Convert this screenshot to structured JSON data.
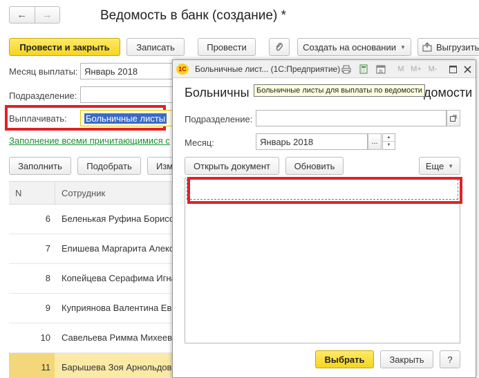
{
  "main": {
    "title": "Ведомость в банк (создание) *",
    "nav": {
      "back": "←",
      "forward": "→"
    },
    "toolbar": {
      "post_close": "Провести и закрыть",
      "save": "Записать",
      "post": "Провести",
      "create_based": "Создать на основании",
      "upload": "Выгрузить"
    },
    "fields": {
      "month_label": "Месяц выплаты:",
      "month_value": "Январь 2018",
      "department_label": "Подразделение:",
      "department_value": "",
      "pay_label": "Выплачивать:",
      "pay_value": "Больничные листы"
    },
    "fill_link": "Заполнение всеми причитающимися с",
    "table_toolbar": {
      "fill": "Заполнить",
      "select": "Подобрать",
      "change": "Изм"
    },
    "table": {
      "columns": [
        "N",
        "Сотрудник"
      ],
      "rows": [
        {
          "n": "6",
          "name": "Беленькая Руфина Борисо"
        },
        {
          "n": "7",
          "name": "Епишева Маргарита Алекс"
        },
        {
          "n": "8",
          "name": "Копейцева Серафима Игна"
        },
        {
          "n": "9",
          "name": "Куприянова Валентина Ев"
        },
        {
          "n": "10",
          "name": "Савельева Римма Михеев"
        },
        {
          "n": "11",
          "name": "Барышева Зоя Арнольдов"
        }
      ]
    }
  },
  "dialog": {
    "window_title": "Больничные лист... (1С:Предприятие)",
    "title_left": "Больничны",
    "title_right": "домости",
    "tooltip": "Больничные листы для выплаты по ведомости",
    "fields": {
      "department_label": "Подразделение:",
      "department_value": "",
      "month_label": "Месяц:",
      "month_value": "Январь 2018",
      "ellipsis": "..."
    },
    "buttons": {
      "open_doc": "Открыть документ",
      "refresh": "Обновить",
      "more": "Еще",
      "select": "Выбрать",
      "close": "Закрыть",
      "help": "?"
    },
    "titlebar_icons": {
      "m": "M",
      "m_plus": "M+",
      "m_minus": "M-"
    }
  },
  "colors": {
    "accent_yellow": "#f5d51d",
    "highlight_red": "#e02127",
    "link_green": "#1a8f2e",
    "selected_text_bg": "#3a6bc6"
  }
}
